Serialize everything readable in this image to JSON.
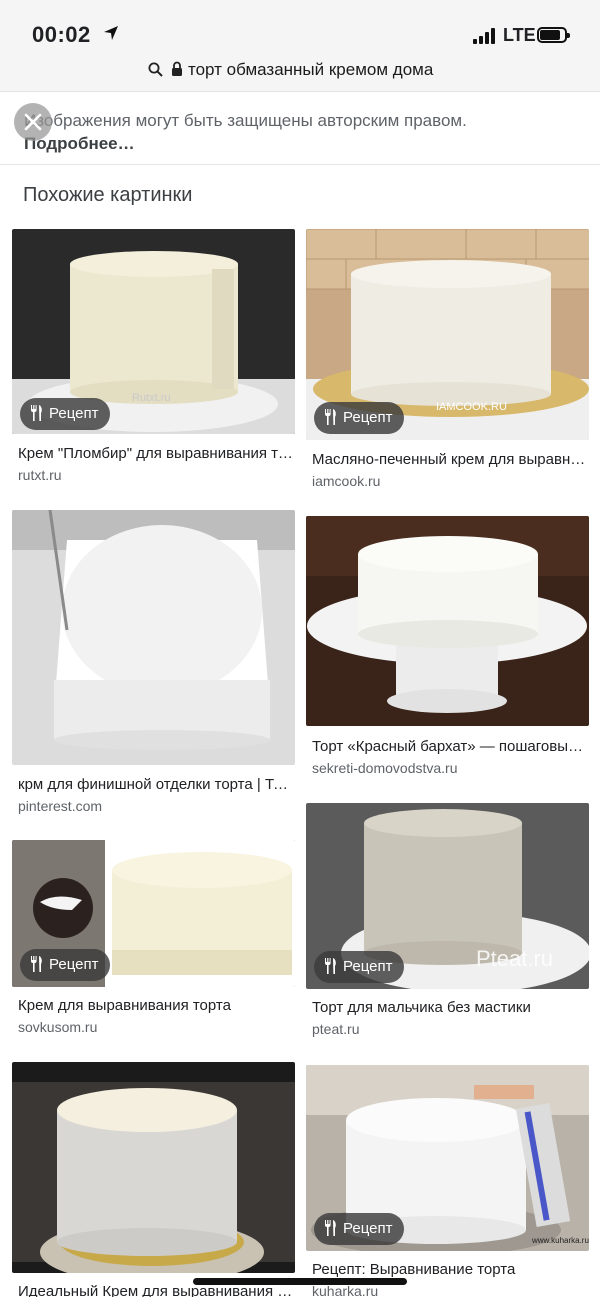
{
  "status_bar": {
    "time": "00:02",
    "network": "LTE"
  },
  "url_bar": {
    "text": "торт обмазанный кремом дома"
  },
  "notice": {
    "text": "Изображения могут быть защищены авторским правом.",
    "more": "Подробнее…"
  },
  "section": {
    "title": "Похожие картинки"
  },
  "results": [
    {
      "badge": "Рецепт",
      "title": "Крем \"Пломбир\" для выравнивания торта",
      "source": "rutxt.ru",
      "watermark": "Rutxt.ru"
    },
    {
      "badge": "Рецепт",
      "title": "Масляно-печенный крем для выравнивания",
      "source": "iamcook.ru",
      "watermark": "IAMCOOK.RU"
    },
    {
      "title": "крм для финишной отделки торта | Торты",
      "source": "pinterest.com"
    },
    {
      "title": "Торт «Красный бархат» — пошаговый рецепт",
      "source": "sekreti-domovodstva.ru"
    },
    {
      "badge": "Рецепт",
      "title": "Крем для выравнивания торта",
      "source": "sovkusom.ru"
    },
    {
      "badge": "Рецепт",
      "title": "Торт для мальчика без мастики",
      "source": "pteat.ru",
      "watermark": "Pteat.ru"
    },
    {
      "title": "Идеальный Крем для выравнивания торта",
      "source": ""
    },
    {
      "badge": "Рецепт",
      "title": "Рецепт: Выравнивание торта",
      "source": "kuharka.ru",
      "watermark": "www.kuharka.ru"
    }
  ],
  "colors": {
    "accent_text": "#202124",
    "secondary_text": "#5f6368",
    "badge_bg": "#3c3c3c"
  },
  "icons": [
    "location-arrow-icon",
    "signal-bars-icon",
    "battery-icon",
    "search-icon",
    "lock-icon",
    "close-icon",
    "fork-knife-icon"
  ]
}
